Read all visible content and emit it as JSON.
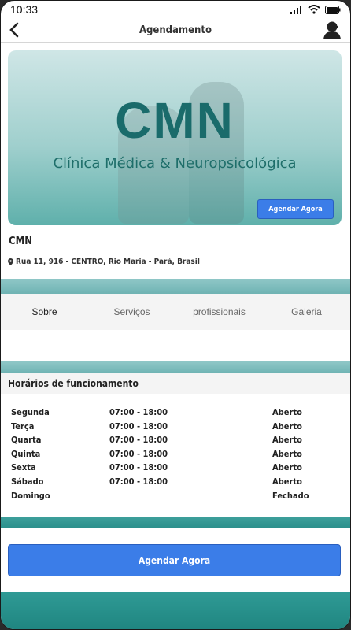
{
  "status": {
    "time": "10:33"
  },
  "header": {
    "title": "Agendamento"
  },
  "banner": {
    "logo_text": "CMN",
    "subtitle": "Clínica Médica & Neuropsicológica",
    "button_label": "Agendar Agora"
  },
  "clinic": {
    "name": "CMN",
    "address": "Rua 11, 916 - CENTRO, Rio Maria - Pará, Brasil"
  },
  "tabs": [
    {
      "label": "Sobre"
    },
    {
      "label": "Serviços"
    },
    {
      "label": "profissionais"
    },
    {
      "label": "Galeria"
    }
  ],
  "hours": {
    "title": "Horários de funcionamento",
    "rows": [
      {
        "day": "Segunda",
        "time": "07:00 - 18:00",
        "status": "Aberto"
      },
      {
        "day": "Terça",
        "time": "07:00 - 18:00",
        "status": "Aberto"
      },
      {
        "day": "Quarta",
        "time": "07:00 - 18:00",
        "status": "Aberto"
      },
      {
        "day": "Quinta",
        "time": "07:00 - 18:00",
        "status": "Aberto"
      },
      {
        "day": "Sexta",
        "time": "07:00 - 18:00",
        "status": "Aberto"
      },
      {
        "day": "Sábado",
        "time": "07:00 - 18:00",
        "status": "Aberto"
      },
      {
        "day": "Domingo",
        "time": "",
        "status": "Fechado"
      }
    ]
  },
  "cta": {
    "label": "Agendar Agora"
  },
  "colors": {
    "accent": "#3b7de8",
    "teal": "#1a6b6b"
  },
  "icons": {
    "back": "chevron-left-icon",
    "profile": "user-icon",
    "location": "map-pin-icon"
  }
}
